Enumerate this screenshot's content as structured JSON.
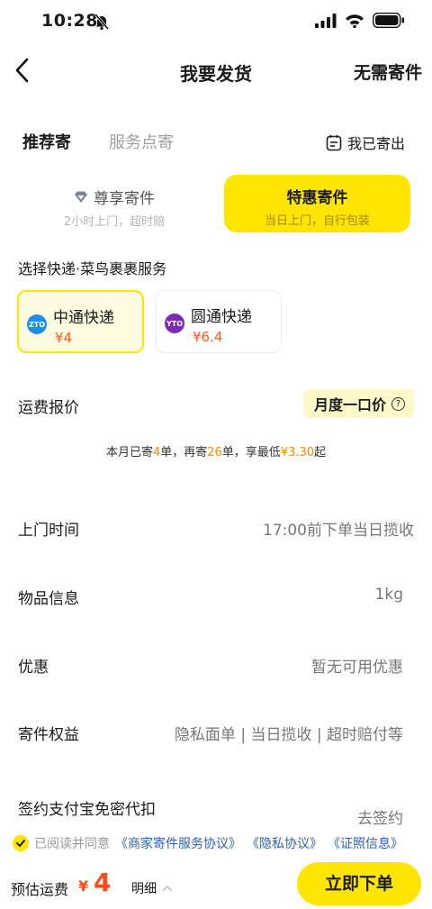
{
  "status": {
    "time": "10:28"
  },
  "nav": {
    "title": "我要发货",
    "right_action": "无需寄件"
  },
  "tabs": {
    "active": "推荐寄",
    "inactive": "服务点寄",
    "shipped": "我已寄出"
  },
  "modes": [
    {
      "title": "尊享寄件",
      "subtitle": "2小时上门，超时赔"
    },
    {
      "title": "特惠寄件",
      "subtitle": "当日上门，自行包装"
    }
  ],
  "courier_section": {
    "label": "选择快递·菜鸟裹裹服务"
  },
  "couriers": [
    {
      "name": "中通快递",
      "price": "¥4",
      "logo_text": "ZTO",
      "logo_color": "#1f8cf0"
    },
    {
      "name": "圆通快递",
      "price": "¥6.4",
      "logo_text": "YTO",
      "logo_color": "#7a2bb5"
    }
  ],
  "quote": {
    "label": "运费报价",
    "badge": "月度一口价"
  },
  "promo": {
    "p1": "本月已寄",
    "n1": "4",
    "p2": "单，再寄",
    "n2": "26",
    "p3": "单，享最低",
    "n3": "¥3.30",
    "p4": "起"
  },
  "rows": [
    {
      "key": "上门时间",
      "value": "17:00前下单当日揽收"
    },
    {
      "key": "物品信息",
      "value": "1kg"
    },
    {
      "key": "优惠",
      "value": "暂无可用优惠"
    },
    {
      "key": "寄件权益",
      "value": "隐私面单 | 当日揽收 | 超时赔付等"
    },
    {
      "key": "签约支付宝免密代扣",
      "value": "去签约"
    }
  ],
  "agreement": {
    "prefix": "已阅读并同意",
    "link1": "《商家寄件服务协议》",
    "link2": "《隐私协议》",
    "link3": "《证照信息》"
  },
  "bottom": {
    "est_label": "预估运费",
    "currency": "¥",
    "amount": "4",
    "detail": "明细",
    "submit": "立即下单"
  },
  "colors": {
    "accent": "#ffe500",
    "price": "#ff4a1c",
    "link": "#2f62b8"
  }
}
